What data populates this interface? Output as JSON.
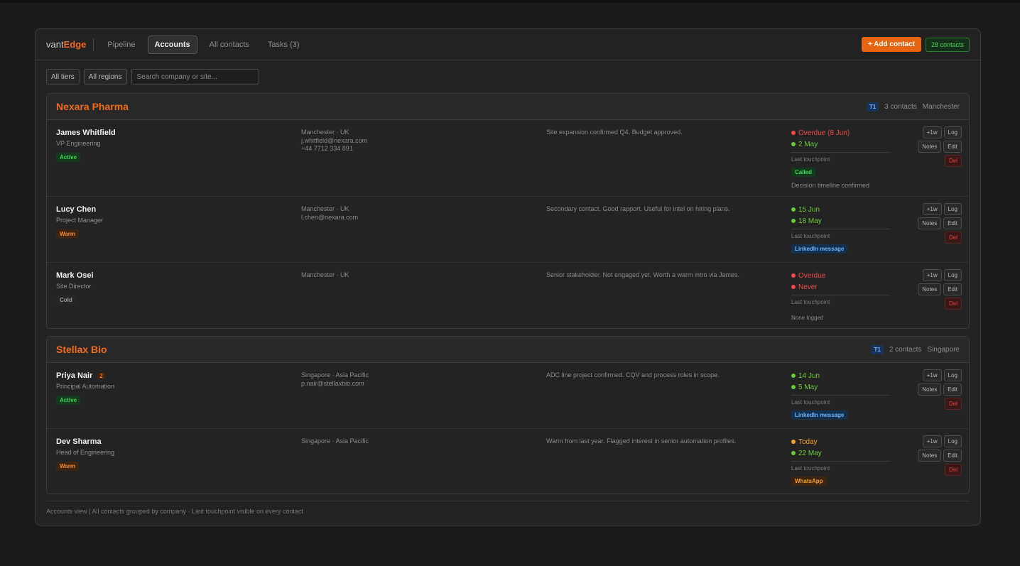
{
  "header": {
    "logo_a": "vant",
    "logo_b": "Edge",
    "tabs": [
      {
        "label": "Pipeline"
      },
      {
        "label": "Accounts"
      },
      {
        "label": "All contacts"
      },
      {
        "label": "Tasks (3)"
      }
    ],
    "add_label": "+ Add contact",
    "contacts_count": "28 contacts"
  },
  "filters": {
    "tier": "All tiers",
    "region": "All regions",
    "search_placeholder": "Search company or site..."
  },
  "companies": [
    {
      "name": "Nexara Pharma",
      "tier": "T1",
      "contacts": "3 contacts",
      "site": "Manchester",
      "people": [
        {
          "name": "James Whitfield",
          "role": "VP Engineering",
          "status": "Active",
          "location": "Manchester · UK",
          "email": "j.whitfield@nexara.com",
          "phone": "+44 7712 334 891",
          "note": "Site expansion confirmed Q4. Budget approved.",
          "next": "Overdue (8 Jun)",
          "last": "2 May",
          "lt_label": "Last touchpoint",
          "channel": "Called",
          "lt_note": "Decision timeline confirmed"
        },
        {
          "name": "Lucy Chen",
          "role": "Project Manager",
          "status": "Warm",
          "location": "Manchester · UK",
          "email": "l.chen@nexara.com",
          "note": "Secondary contact. Good rapport. Useful for intel on hiring plans.",
          "next": "15 Jun",
          "last": "18 May",
          "lt_label": "Last touchpoint",
          "channel": "LinkedIn message"
        },
        {
          "name": "Mark Osei",
          "role": "Site Director",
          "status": "Cold",
          "location": "Manchester · UK",
          "note": "Senior stakeholder. Not engaged yet. Worth a warm intro via James.",
          "next": "Overdue",
          "last": "Never",
          "lt_label": "Last touchpoint",
          "lt_note": "None logged"
        }
      ]
    },
    {
      "name": "Stellax Bio",
      "tier": "T1",
      "contacts": "2 contacts",
      "site": "Singapore",
      "people": [
        {
          "name": "Priya Nair",
          "badge": "2",
          "role": "Principal Automation",
          "status": "Active",
          "location": "Singapore · Asia Pacific",
          "email": "p.nair@stellaxbio.com",
          "note": "ADC line project confirmed. CQV and process roles in scope.",
          "next": "14 Jun",
          "last": "5 May",
          "lt_label": "Last touchpoint",
          "channel": "LinkedIn message"
        },
        {
          "name": "Dev Sharma",
          "role": "Head of Engineering",
          "status": "Warm",
          "location": "Singapore · Asia Pacific",
          "note": "Warm from last year. Flagged interest in senior automation profiles.",
          "next": "Today",
          "last": "22 May",
          "lt_label": "Last touchpoint",
          "channel": "WhatsApp"
        }
      ]
    }
  ],
  "actions": {
    "plus_week": "+1w",
    "log": "Log",
    "notes": "Notes",
    "edit": "Edit",
    "del": "Del"
  },
  "footer": "Accounts view  |  All contacts grouped by company  ·  Last touchpoint visible on every contact",
  "colors": {
    "accent": "#f06a1e",
    "overdue": "#f04848",
    "ok": "#6bc83a",
    "today": "#f0a030"
  }
}
